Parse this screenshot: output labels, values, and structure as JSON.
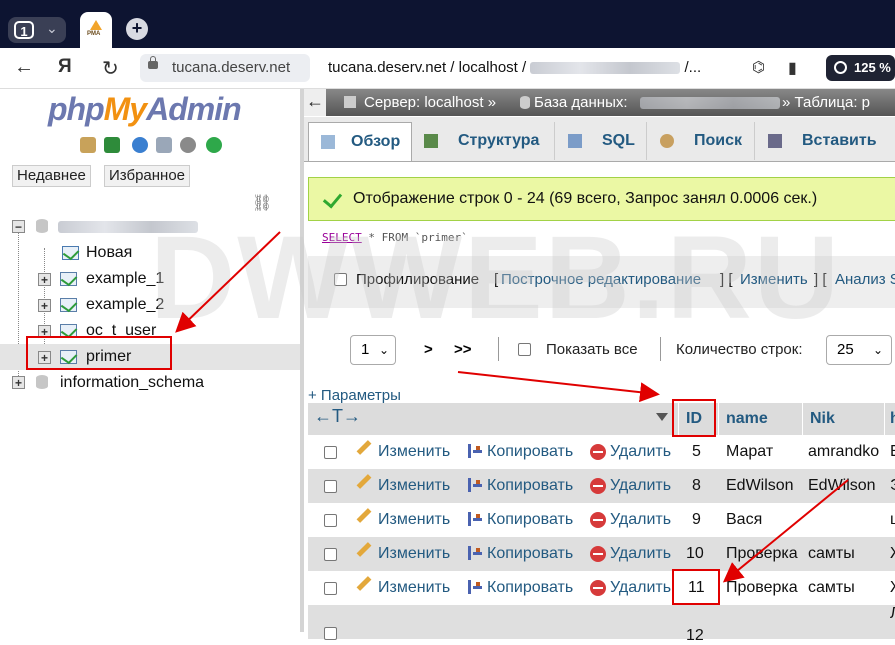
{
  "browser": {
    "tab_count": "1",
    "new_tab_symbol": "+",
    "favicon_text": "PMA",
    "url_host": "tucana.deserv.net",
    "url_path_prefix": "tucana.deserv.net / localhost /",
    "url_path_suffix": "/...",
    "zoom": "125 %"
  },
  "sidebar": {
    "logo_php": "php",
    "logo_my": "My",
    "logo_admin": "Admin",
    "tab_recent": "Недавнее",
    "tab_favorites": "Избранное",
    "tree": {
      "new_item": "Новая",
      "tables": [
        "example_1",
        "example_2",
        "oc_t_user",
        "primer"
      ],
      "other_db": "information_schema"
    }
  },
  "main": {
    "breadcrumb_server": "Сервер: localhost »",
    "breadcrumb_db": "База данных:",
    "breadcrumb_table": "» Таблица: p",
    "tabs": [
      "Обзор",
      "Структура",
      "SQL",
      "Поиск",
      "Вставить"
    ],
    "message": "Отображение строк 0 - 24 (69 всего, Запрос занял 0.0006 сек.)",
    "sql_select": "SELECT",
    "sql_rest": "* FROM `primer`",
    "profiling_label": "Профилирование",
    "profiling_links": [
      "Построчное редактирование",
      "Изменить",
      "Анализ S"
    ],
    "pager": {
      "page": "1",
      "next": ">",
      "last": ">>",
      "show_all": "Показать все",
      "rows_label": "Количество строк:",
      "rows_value": "25"
    },
    "params_link": "+ Параметры",
    "columns": [
      "ID",
      "name",
      "Nik",
      "h"
    ],
    "actions": {
      "edit": "Изменить",
      "copy": "Копировать",
      "delete": "Удалить"
    },
    "rows": [
      {
        "id": "5",
        "name": "Марат",
        "nik": "amrandko",
        "extra": "E"
      },
      {
        "id": "8",
        "name": "EdWilson",
        "nik": "EdWilson",
        "extra": "Э"
      },
      {
        "id": "9",
        "name": "Вася",
        "nik": "",
        "extra": "ц"
      },
      {
        "id": "10",
        "name": "Проверка",
        "nik": "самты",
        "extra": "Ж"
      },
      {
        "id": "11",
        "name": "Проверка",
        "nik": "самты",
        "extra": "Ж"
      },
      {
        "id": "12",
        "name": "",
        "nik": "",
        "extra": "Л"
      }
    ]
  },
  "watermark": "DWWEB.RU",
  "colors": {
    "annotation_red": "#e00000",
    "link_blue": "#235a81",
    "success_bg": "#ebf8a4"
  }
}
